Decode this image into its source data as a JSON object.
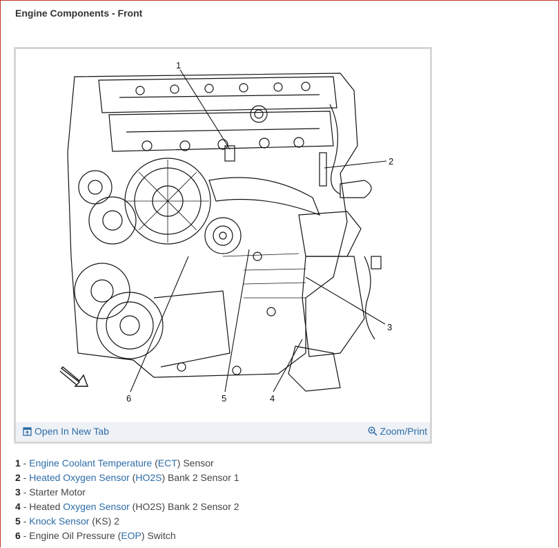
{
  "page": {
    "title": "Engine Components - Front"
  },
  "figure": {
    "callouts": [
      "1",
      "2",
      "3",
      "4",
      "5",
      "6"
    ],
    "open_tab_label": "Open In New Tab",
    "zoom_label": "Zoom/Print"
  },
  "legend": [
    {
      "num": "1",
      "sep": " - ",
      "parts": [
        {
          "text": "Engine Coolant Temperature",
          "link": true
        },
        {
          "text": " (",
          "link": false
        },
        {
          "text": "ECT",
          "link": true
        },
        {
          "text": ") Sensor",
          "link": false
        }
      ]
    },
    {
      "num": "2",
      "sep": " - ",
      "parts": [
        {
          "text": "Heated Oxygen Sensor",
          "link": true
        },
        {
          "text": " (",
          "link": false
        },
        {
          "text": "HO2S",
          "link": true
        },
        {
          "text": ") Bank 2 Sensor 1",
          "link": false
        }
      ]
    },
    {
      "num": "3",
      "sep": " - ",
      "parts": [
        {
          "text": "Starter Motor",
          "link": false
        }
      ]
    },
    {
      "num": "4",
      "sep": " - ",
      "parts": [
        {
          "text": "Heated ",
          "link": false
        },
        {
          "text": "Oxygen Sensor",
          "link": true
        },
        {
          "text": " (HO2S) Bank 2 Sensor 2",
          "link": false
        }
      ]
    },
    {
      "num": "5",
      "sep": " - ",
      "parts": [
        {
          "text": "Knock Sensor",
          "link": true
        },
        {
          "text": " (KS) 2",
          "link": false
        }
      ]
    },
    {
      "num": "6",
      "sep": " - ",
      "parts": [
        {
          "text": "Engine Oil Pressure (",
          "link": false
        },
        {
          "text": "EOP",
          "link": true
        },
        {
          "text": ") Switch",
          "link": false
        }
      ]
    }
  ]
}
